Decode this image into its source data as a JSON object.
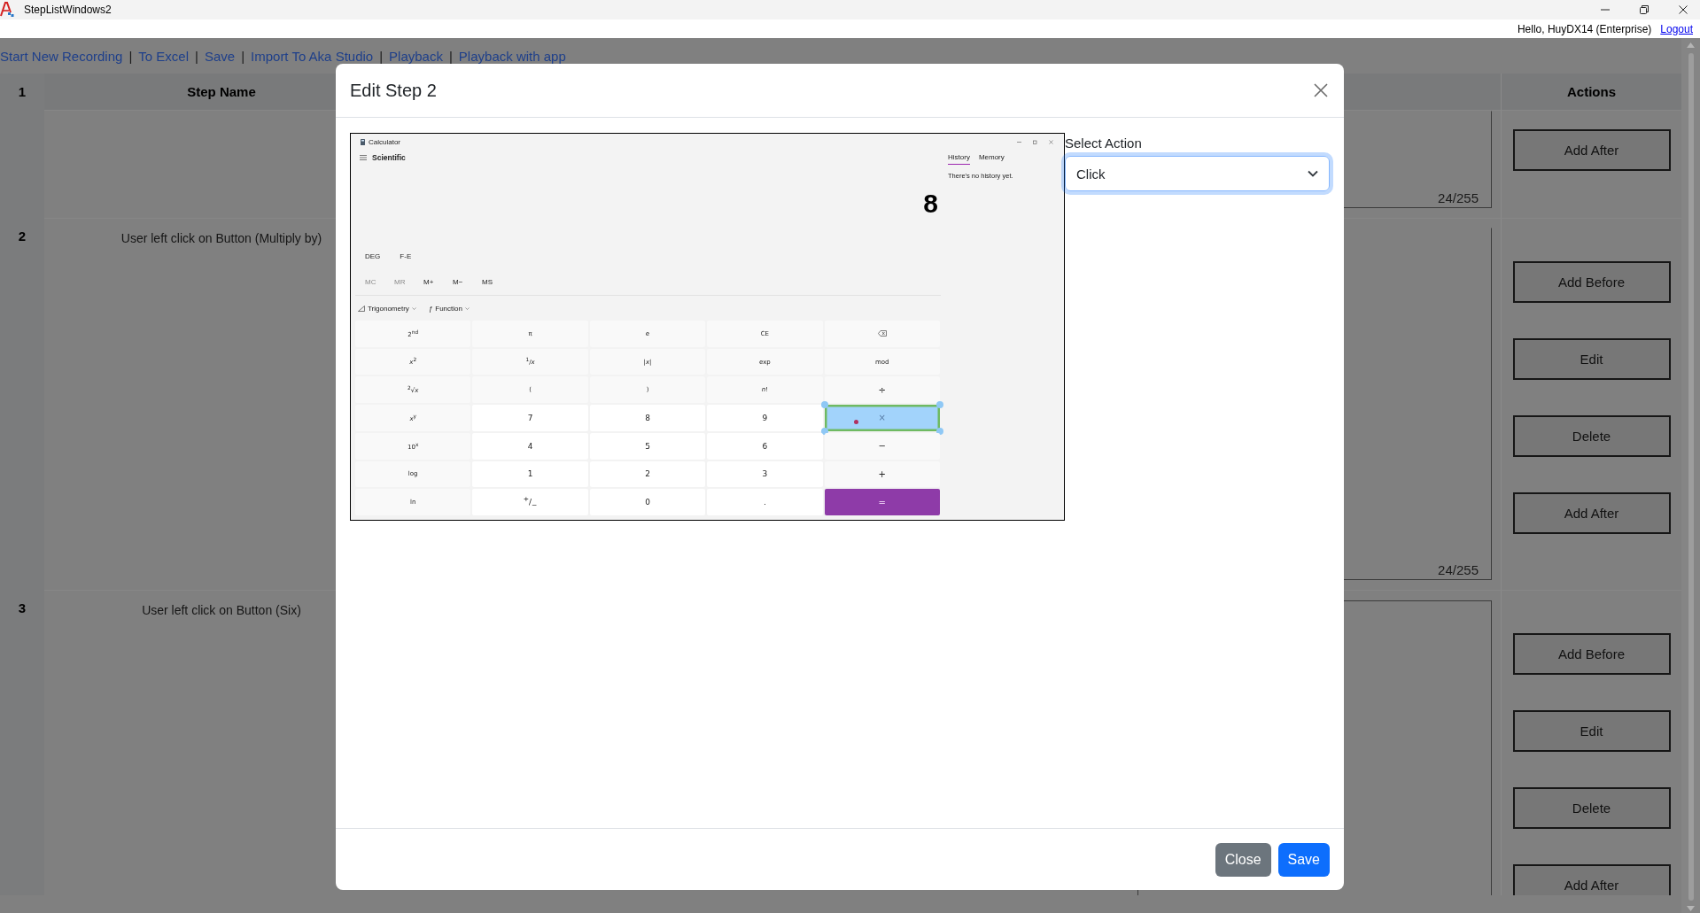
{
  "window": {
    "title": "StepListWindows2"
  },
  "user_bar": {
    "greeting": "Hello, HuyDX14 (Enterprise)",
    "logout": "Logout"
  },
  "nav": [
    {
      "kind": "link",
      "label": "Start New Recording"
    },
    {
      "kind": "separator",
      "label": "|"
    },
    {
      "kind": "link",
      "label": "To Excel"
    },
    {
      "kind": "separator",
      "label": "|"
    },
    {
      "kind": "link",
      "label": "Save"
    },
    {
      "kind": "separator",
      "label": "|"
    },
    {
      "kind": "link",
      "label": "Import To Aka Studio"
    },
    {
      "kind": "separator",
      "label": "|"
    },
    {
      "kind": "link",
      "label": "Playback"
    },
    {
      "kind": "separator",
      "label": "|"
    },
    {
      "kind": "link",
      "label": "Playback with app"
    }
  ],
  "table": {
    "header": {
      "number": "1",
      "step_name": "Step Name",
      "actions": "Actions"
    },
    "rows": [
      {
        "counter": "24/255",
        "actions": [
          "Add After"
        ]
      },
      {
        "number": "2",
        "step_name": "User left click on Button (Multiply by)",
        "counter": "24/255",
        "actions": [
          "Add Before",
          "Edit",
          "Delete",
          "Add After"
        ]
      },
      {
        "number": "3",
        "step_name": "User left click on Button (Six)",
        "actions": [
          "Add Before",
          "Edit",
          "Delete",
          "Add After"
        ]
      }
    ]
  },
  "modal": {
    "title": "Edit Step 2",
    "calculator": {
      "title": "Calculator",
      "mode": "Scientific",
      "display": "8",
      "angle": "DEG",
      "notation": "F-E",
      "memory": [
        {
          "label": "MC",
          "disabled": true
        },
        {
          "label": "MR",
          "disabled": true
        },
        {
          "label": "M+",
          "disabled": false
        },
        {
          "label": "M−",
          "disabled": false
        },
        {
          "label": "MS",
          "disabled": false
        }
      ],
      "trig_menu": "Trigonometry",
      "function_menu": {
        "icon": "ƒ",
        "label": "Function"
      },
      "panel_tabs": [
        {
          "label": "History",
          "selected": true
        },
        {
          "label": "Memory",
          "selected": false
        }
      ],
      "history_empty": "There's no history yet.",
      "keys": [
        {
          "label": "2$^{nd}$",
          "kind": "function",
          "selected": false
        },
        {
          "label": "π",
          "kind": "function",
          "selected": false
        },
        {
          "label": "e",
          "kind": "function",
          "selected": false
        },
        {
          "label": "CE",
          "kind": "function",
          "selected": false
        },
        {
          "kind": "backspace",
          "selected": false
        },
        {
          "label": "*x*$^{2}$",
          "kind": "function",
          "selected": false
        },
        {
          "label": "$^{1}$/*x*",
          "kind": "function",
          "selected": false
        },
        {
          "label": "|*x*|",
          "kind": "function",
          "selected": false
        },
        {
          "label": "exp",
          "kind": "function",
          "selected": false
        },
        {
          "label": "mod",
          "kind": "function",
          "selected": false
        },
        {
          "label": "$^{2}$√*x*",
          "kind": "function",
          "selected": false
        },
        {
          "label": "(",
          "kind": "function",
          "selected": false
        },
        {
          "label": ")",
          "kind": "function",
          "selected": false
        },
        {
          "label": "*n*!",
          "kind": "function",
          "selected": false
        },
        {
          "label": "÷",
          "kind": "operator",
          "selected": false
        },
        {
          "label": "*x*$^{y}$",
          "kind": "function",
          "selected": false
        },
        {
          "label": "7",
          "kind": "digit",
          "selected": false
        },
        {
          "label": "8",
          "kind": "digit",
          "selected": false
        },
        {
          "label": "9",
          "kind": "digit",
          "selected": false
        },
        {
          "label": "×",
          "kind": "operator",
          "selected": true
        },
        {
          "label": "10$^{x}$",
          "kind": "function",
          "selected": false
        },
        {
          "label": "4",
          "kind": "digit",
          "selected": false
        },
        {
          "label": "5",
          "kind": "digit",
          "selected": false
        },
        {
          "label": "6",
          "kind": "digit",
          "selected": false
        },
        {
          "label": "−",
          "kind": "operator",
          "selected": false
        },
        {
          "label": "log",
          "kind": "function",
          "selected": false
        },
        {
          "label": "1",
          "kind": "digit",
          "selected": false
        },
        {
          "label": "2",
          "kind": "digit",
          "selected": false
        },
        {
          "label": "3",
          "kind": "digit",
          "selected": false
        },
        {
          "label": "+",
          "kind": "operator",
          "selected": false
        },
        {
          "label": "ln",
          "kind": "function",
          "selected": false
        },
        {
          "label": "$^{+}$/$_{−}$",
          "kind": "digit",
          "selected": false
        },
        {
          "label": "0",
          "kind": "digit",
          "selected": false
        },
        {
          "label": ".",
          "kind": "digit",
          "selected": false
        },
        {
          "label": "=",
          "kind": "equals",
          "selected": false
        }
      ]
    },
    "select": {
      "label": "Select Action",
      "value": "Click",
      "focused": true
    },
    "buttons": [
      {
        "label": "Close",
        "kind": "secondary"
      },
      {
        "label": "Save",
        "kind": "primary"
      }
    ]
  }
}
